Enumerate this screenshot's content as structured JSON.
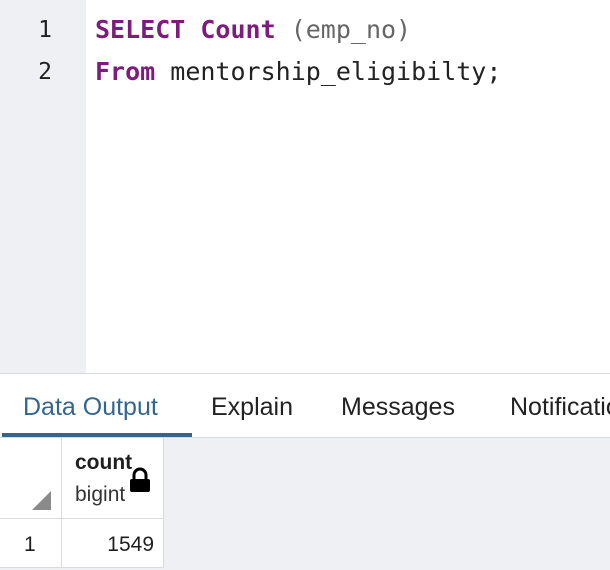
{
  "editor": {
    "lines": [
      {
        "number": "1",
        "keyword1": "SELECT",
        "keyword2": "Count",
        "paren": "(emp_no)"
      },
      {
        "number": "2",
        "keyword": "From",
        "text": "mentorship_eligibilty;"
      }
    ]
  },
  "tabs": [
    {
      "label": "Data Output",
      "active": true
    },
    {
      "label": "Explain"
    },
    {
      "label": "Messages"
    },
    {
      "label": "Notifications"
    }
  ],
  "grid": {
    "columns": [
      {
        "name": "count",
        "type": "bigint",
        "icon": "lock-icon"
      }
    ],
    "rows": [
      {
        "number": "1",
        "values": [
          "1549"
        ]
      }
    ]
  },
  "colors": {
    "keyword": "#7d1b7e",
    "accent": "#326690",
    "gutter": "#eef0f4"
  }
}
